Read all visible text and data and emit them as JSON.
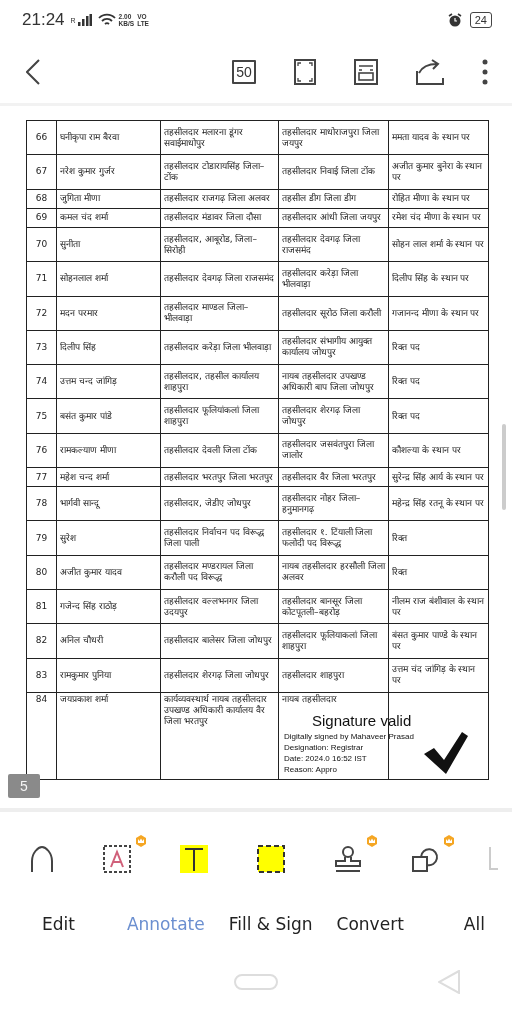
{
  "status_bar": {
    "time": "21:24",
    "network": "R",
    "speed": "2.00",
    "speed_unit": "KB/S",
    "volte_top": "VO",
    "volte_bottom": "LTE",
    "battery": "24"
  },
  "toolbar": {
    "page_button": "50"
  },
  "document": {
    "page_badge": "5",
    "table": {
      "rows": [
        {
          "cells": [
            "66",
            "घनीकृपा राम बैरवा",
            "तहसीलदार मलारना डूंगर सवाईमाधोपुर",
            "तहसीलदार माधोराजपुरा जिला जयपुर",
            "ममता यादव के स्थान पर"
          ]
        },
        {
          "cells": [
            "67",
            "नरेश कुमार गुर्जर",
            "तहसीलदार टोडारायसिंह जिला– टोंक",
            "तहसीलदार निवाई जिला टोंक",
            "अजीत कुमार बुनेरा के स्थान पर"
          ]
        },
        {
          "cells": [
            "68",
            "जुगिता मीणा",
            "तहसीलदार राजगढ़ जिला अलवर",
            "तहसील डीग जिला डीग",
            "रोहित मीणा के स्थान पर"
          ]
        },
        {
          "cells": [
            "69",
            "कमल चंद शर्मा",
            "तहसीलदार मंडावर जिला दौसा",
            "तहसीलदार आंधी जिला जयपुर",
            "रमेश चंद मीणा के स्थान पर"
          ]
        },
        {
          "cells": [
            "70",
            "सुनीता",
            "तहसीलदार, आबूरोड, जिला–सिरोही",
            "तहसीलदार देवगढ़ जिला राजसमंद",
            "सोहन लाल शर्मा के स्थान पर"
          ]
        },
        {
          "cells": [
            "71",
            "सोहनलाल शर्मा",
            "तहसीलदार देवगढ़ जिला राजसमंद",
            "तहसीलदार करेड़ा जिला भीलवाड़ा",
            "दिलीप सिंह के स्थान पर"
          ]
        },
        {
          "cells": [
            "72",
            "मदन परमार",
            "तहसीलदार माण्डल जिला–भीलवाड़ा",
            "तहसीलदार सूरोठ जिला करौली",
            "गजानन्द मीणा के स्थान पर"
          ]
        },
        {
          "cells": [
            "73",
            "दिलीप सिंह",
            "तहसीलदार करेड़ा जिला भीलवाड़ा",
            "तहसीलदार संभागीय आयुक्त कार्यालय जोधपुर",
            "रिक्त पद"
          ]
        },
        {
          "cells": [
            "74",
            "उत्तम चन्द जांगिड़",
            "तहसीलदार, तहसील कार्यालय शाहपुरा",
            "नायब तहसीलदार उपखण्ड अधिकारी बाप जिला जोधपुर",
            "रिक्त पद"
          ]
        },
        {
          "cells": [
            "75",
            "बसंत कुमार पांडे",
            "तहसीलदार फूलियांकलां जिला शाहपुरा",
            "तहसीलदार शेरगढ़ जिला जोधपुर",
            "रिक्त पद"
          ]
        },
        {
          "cells": [
            "76",
            "रामकल्याण मीणा",
            "तहसीलदार देवली जिला टोंक",
            "तहसीलदार जसवंतपुरा जिला जालोर",
            "कौशल्या के स्थान पर"
          ]
        },
        {
          "cells": [
            "77",
            "महेश चन्द शर्मा",
            "तहसीलदार भरतपुर जिला भरतपुर",
            "तहसीलदार वैर जिला भरतपुर",
            "सुरेन्द्र सिंह आर्य के स्थान पर"
          ]
        },
        {
          "cells": [
            "78",
            "भार्गवी सान्दू",
            "तहसीलदार, जेडीए जोधपुर",
            "तहसीलदार नोहर जिला–हनुमानगढ़",
            "महेन्द्र सिंह रतनू के स्थान पर"
          ]
        },
        {
          "cells": [
            "79",
            "सुरेश",
            "तहसीलदार निर्वाचन पद विरूद्ध जिला पाली",
            "तहसीलदार १. टिंयाली जिला फलोदी पद विरूद्ध",
            "रिक्त"
          ]
        },
        {
          "cells": [
            "80",
            "अजीत कुमार यादव",
            "तहसीलदार मण्डरायल जिला करौली पद विरूद्ध",
            "नायब तहसीलदार हरसौली जिला अलवर",
            "रिक्त"
          ]
        },
        {
          "cells": [
            "81",
            "गजेन्द सिंह राठोड़",
            "तहसीलदार वल्लभनगर जिला उदयपुर",
            "तहसीलदार बानसूर जिला कोटपूतली–बहरोड़",
            "नीलम राज बंशीवाल के स्थान पर"
          ]
        },
        {
          "cells": [
            "82",
            "अनिल चौधरी",
            "तहसीलदार बालेसर जिला जोधपुर",
            "तहसीलदार फूलियाकलां जिला शाहपुरा",
            "बंसत कुमार पाण्डे के स्थान पर"
          ]
        },
        {
          "cells": [
            "83",
            "रामकुमार पुनिया",
            "तहसीलदार शेरगढ़ जिला जोधपुर",
            "तहसीलदार शाहपुरा",
            "उत्तम चंद जांगिड़ के स्थान पर"
          ]
        },
        {
          "cells": [
            "84",
            "जयप्रकाश शर्मा",
            "कार्यव्यवस्थार्थ नायब तहसीलदार उपखण्ड अधिकारी कार्यालय वैर जिला भरतपुर",
            "नायब तहसीलदार",
            ""
          ]
        }
      ]
    },
    "signature": {
      "title": "Signature valid",
      "lines": [
        "Digitally signed by Mahaveer Prasad",
        "Designation: Registrar",
        "Date: 2024.0   16:52 IST",
        "Reason: Appro"
      ]
    }
  },
  "tools": [
    {
      "kind": "pen",
      "premium": false
    },
    {
      "kind": "text-box",
      "premium": true
    },
    {
      "kind": "highlight",
      "premium": false
    },
    {
      "kind": "area",
      "premium": false
    },
    {
      "kind": "stamp",
      "premium": true
    },
    {
      "kind": "shapes",
      "premium": true
    },
    {
      "kind": "partial",
      "premium": false
    }
  ],
  "tabs": [
    {
      "label": "Edit",
      "selected": false
    },
    {
      "label": "Annotate",
      "selected": true
    },
    {
      "label": "Fill & Sign",
      "selected": false
    },
    {
      "label": "Convert",
      "selected": false
    },
    {
      "label": "All",
      "selected": false
    }
  ]
}
